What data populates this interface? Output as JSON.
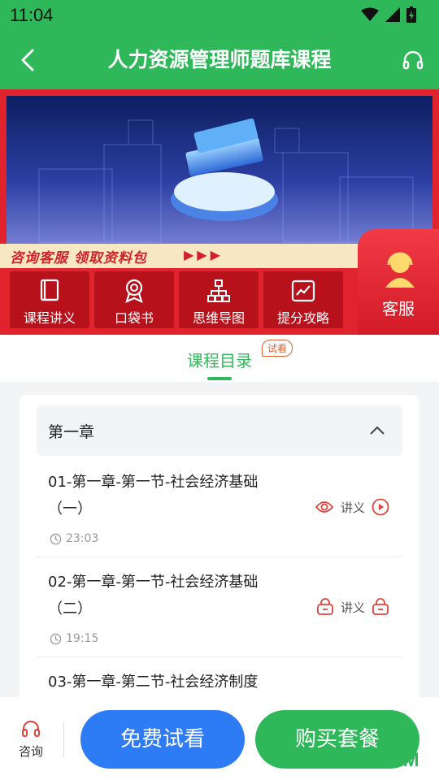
{
  "status": {
    "time": "11:04"
  },
  "header": {
    "title": "人力资源管理师题库课程"
  },
  "banner": {
    "strip_text": "咨询客服  领取资料包",
    "arrows": "▶▶▶",
    "buttons": [
      {
        "label": "课程讲义",
        "icon": "book-icon"
      },
      {
        "label": "口袋书",
        "icon": "award-icon"
      },
      {
        "label": "思维导图",
        "icon": "mindmap-icon"
      },
      {
        "label": "提分攻略",
        "icon": "chart-icon"
      }
    ],
    "service_label": "客服"
  },
  "tab": {
    "label": "课程目录",
    "badge": "试看"
  },
  "chapter": {
    "label": "第一章"
  },
  "lessons": [
    {
      "title": "01-第一章-第一节-社会经济基础（一）",
      "duration": "23:03",
      "handout": "讲义",
      "locked": false
    },
    {
      "title": "02-第一章-第一节-社会经济基础（二）",
      "duration": "19:15",
      "handout": "讲义",
      "locked": true
    },
    {
      "title": "03-第一章-第二节-社会经济制度",
      "duration": "",
      "handout": "",
      "locked": true
    }
  ],
  "bottom": {
    "consult_label": "咨询",
    "free_label": "免费试看",
    "buy_label": "购买套餐"
  },
  "watermark": "ITMOP.COM",
  "colors": {
    "primary_green": "#2fb85a",
    "banner_red": "#e0232c",
    "free_blue": "#2e7bf6",
    "lock_red": "#e0443c"
  }
}
